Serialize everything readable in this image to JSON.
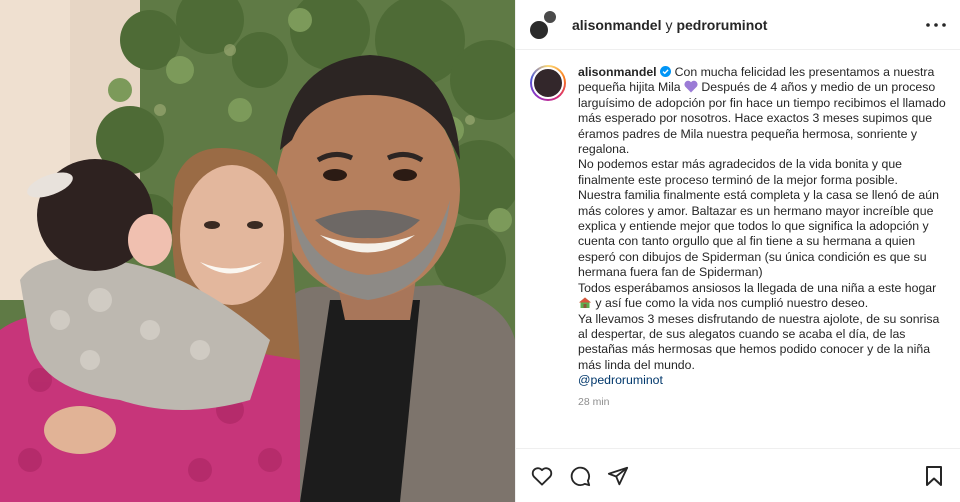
{
  "header": {
    "username_1": "alisonmandel",
    "conjunction": "y",
    "username_2": "pedroruminot"
  },
  "caption": {
    "author": "alisonmandel",
    "paragraphs": {
      "p1_a": "Con mucha felicidad les presentamos a nuestra pequeña hijita Mila",
      "p1_b": "Después de 4 años y medio de un proceso larguísimo de adopción por fin hace un tiempo recibimos el llamado más esperado por nosotros. Hace exactos 3 meses supimos que éramos padres de Mila nuestra pequeña hermosa, sonriente y regalona.",
      "p2": "No podemos estar más agradecidos de la vida bonita y que finalmente este proceso terminó de la mejor forma posible.",
      "p3": "Nuestra familia finalmente está completa y la casa se llenó de aún más colores y amor. Baltazar es un hermano mayor increíble que explica y entiende mejor que todos lo que significa la adopción y cuenta con tanto orgullo que al fin tiene a su hermana a quien esperó con dibujos de Spiderman (su única condición es que su hermana fuera fan de Spiderman)",
      "p4_a": "Todos esperábamos ansiosos la llegada de una niña a este hogar",
      "p4_b": "y así fue como la vida nos cumplió nuestro deseo.",
      "p5": "Ya llevamos 3 meses disfrutando de nuestra ajolote, de su sonrisa al despertar, de sus alegatos cuando se acaba el día, de las pestañas más hermosas que hemos podido conocer y de la niña más linda del mundo."
    },
    "mention": "@pedroruminot",
    "timestamp": "28 min"
  },
  "icons": {
    "heart": "heart-icon",
    "comment": "comment-icon",
    "share": "share-icon",
    "save": "bookmark-icon",
    "more": "more-options-icon",
    "verified": "verified-badge-icon"
  },
  "colors": {
    "verified_blue": "#0095f6",
    "mention_blue": "#00376b",
    "heart_purple": "#9b7bd6",
    "muted": "#8e8e8e"
  }
}
